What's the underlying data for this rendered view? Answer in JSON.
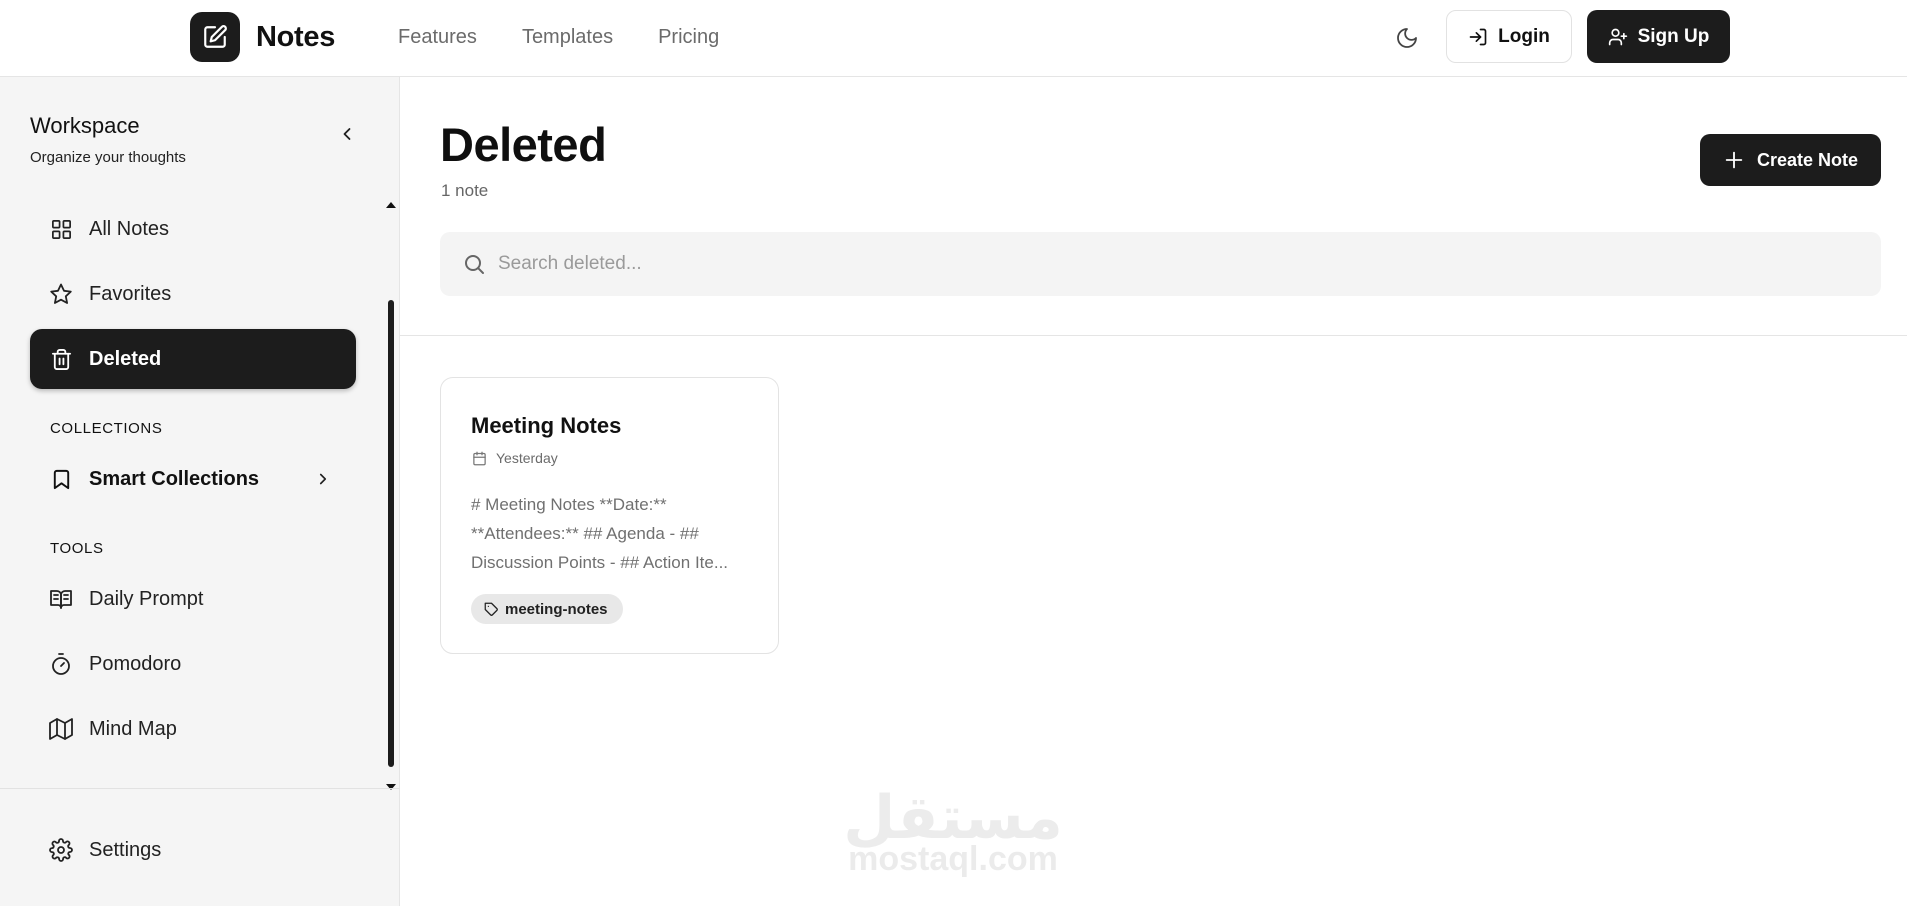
{
  "header": {
    "brand_name": "Notes",
    "nav_links": [
      "Features",
      "Templates",
      "Pricing"
    ],
    "login_label": "Login",
    "signup_label": "Sign Up"
  },
  "sidebar": {
    "title": "Workspace",
    "subtitle": "Organize your thoughts",
    "items": [
      {
        "label": "All Notes",
        "icon": "grid-icon"
      },
      {
        "label": "Favorites",
        "icon": "star-icon"
      },
      {
        "label": "Deleted",
        "icon": "trash-icon",
        "active": true
      }
    ],
    "collections_label": "COLLECTIONS",
    "smart_collections_label": "Smart Collections",
    "tools_label": "TOOLS",
    "tools": [
      {
        "label": "Daily Prompt",
        "icon": "book-open-icon"
      },
      {
        "label": "Pomodoro",
        "icon": "timer-icon"
      },
      {
        "label": "Mind Map",
        "icon": "map-icon"
      }
    ],
    "settings_label": "Settings"
  },
  "main": {
    "title": "Deleted",
    "count": "1 note",
    "create_label": "Create Note",
    "search_placeholder": "Search deleted...",
    "notes": [
      {
        "title": "Meeting Notes",
        "date": "Yesterday",
        "preview": "# Meeting Notes **Date:** **Attendees:** ## Agenda - ## Discussion Points - ## Action Ite...",
        "tag": "meeting-notes"
      }
    ]
  },
  "watermark": {
    "arabic": "مستقل",
    "latin": "mostaql.com"
  },
  "colors": {
    "accent": "#1c1c1c",
    "sidebar_bg": "#f5f5f5",
    "search_bg": "#f4f4f4",
    "tag_bg": "#e8e8e8"
  }
}
